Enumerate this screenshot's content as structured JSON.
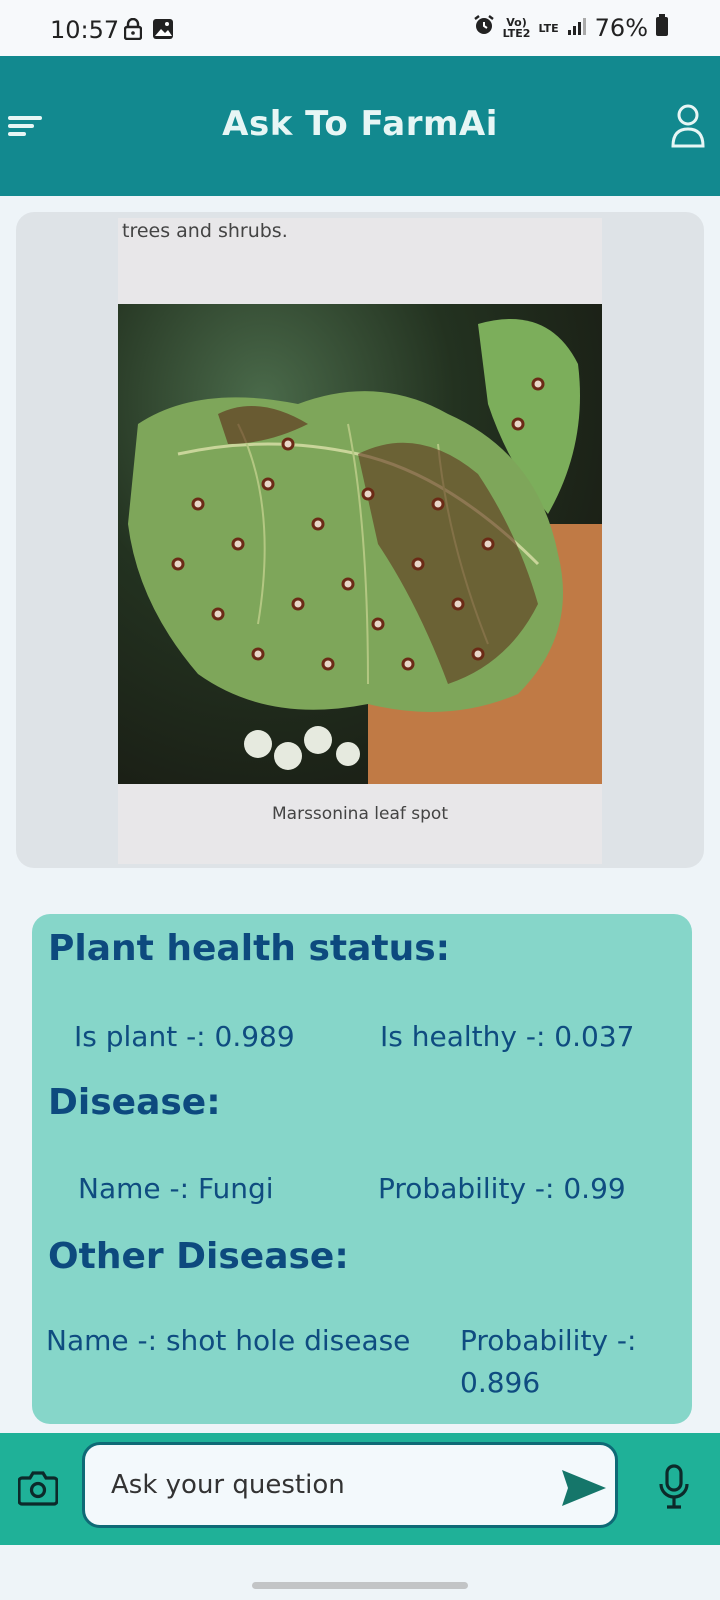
{
  "status_bar": {
    "time": "10:57",
    "network_line1": "Vo)",
    "network_line2": "LTE2",
    "lte": "LTE",
    "battery": "76%"
  },
  "header": {
    "title": "Ask To FarmAi"
  },
  "image_message": {
    "caption_top": "trees and shrubs.",
    "caption_bottom": "Marssonina leaf spot"
  },
  "result": {
    "plant_health_title": "Plant health status:",
    "is_plant": "Is plant -: 0.989",
    "is_healthy": "Is healthy -: 0.037",
    "disease_title": "Disease:",
    "disease_name": "Name -: Fungi",
    "disease_probability": "Probability -: 0.99",
    "other_disease_title": "Other Disease:",
    "other_name": "Name -: shot hole disease",
    "other_probability_line1": "Probability -:",
    "other_probability_line2": "0.896"
  },
  "composer": {
    "placeholder": "Ask your question"
  },
  "colors": {
    "header": "#12898f",
    "result_card": "#86d6c9",
    "bottom_bar": "#1fb198",
    "text_dark_blue": "#0d4a7e"
  },
  "icons": [
    "lock-icon",
    "image-icon",
    "alarm-icon",
    "signal-icon",
    "battery-icon",
    "menu-icon",
    "profile-icon",
    "camera-icon",
    "send-icon",
    "mic-icon"
  ]
}
